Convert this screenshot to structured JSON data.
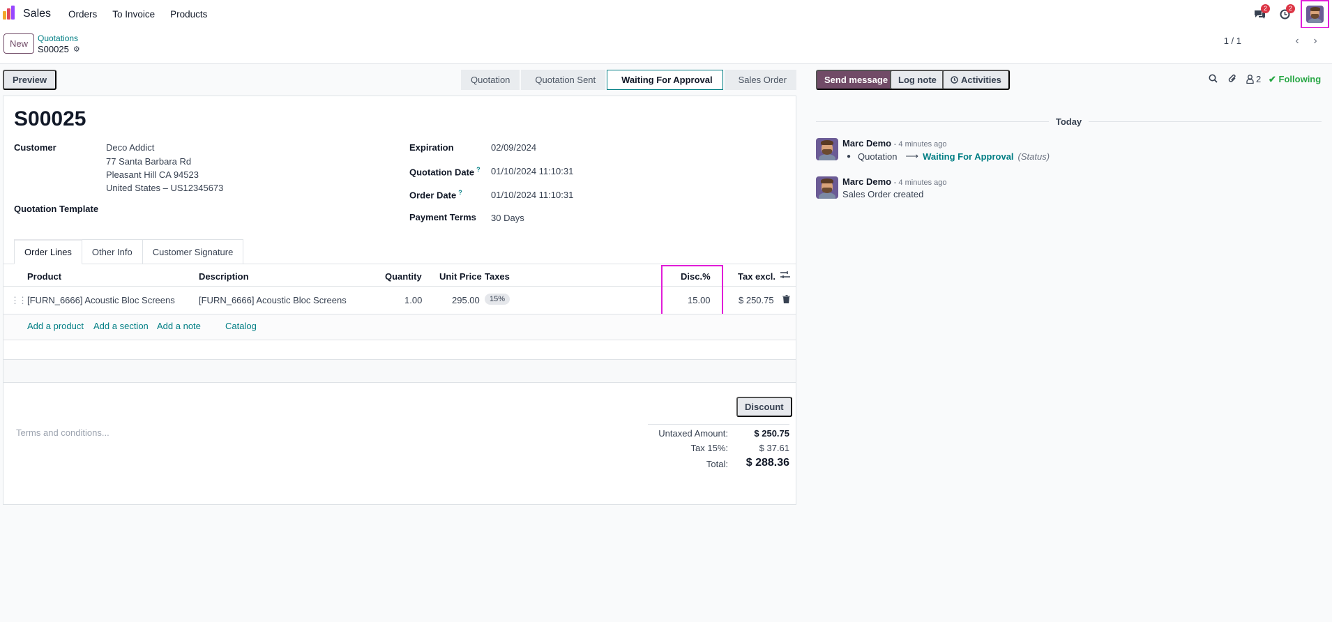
{
  "navbar": {
    "app_name": "Sales",
    "menu": [
      "Orders",
      "To Invoice",
      "Products"
    ],
    "messages_badge": "2",
    "activities_badge": "2",
    "brand_colors": [
      "#f2a62b",
      "#e0475b",
      "#9747ff"
    ]
  },
  "control": {
    "new_label": "New",
    "breadcrumb": "Quotations",
    "record_name": "S00025",
    "pager": "1 / 1"
  },
  "statusbar": {
    "preview_label": "Preview",
    "stages": [
      "Quotation",
      "Quotation Sent",
      "Waiting For Approval",
      "Sales Order"
    ],
    "active_stage": "Waiting For Approval"
  },
  "form": {
    "title": "S00025",
    "customer_label": "Customer",
    "customer_name": "Deco Addict",
    "customer_street": "77 Santa Barbara Rd",
    "customer_city": "Pleasant Hill CA 94523",
    "customer_country": "United States – US12345673",
    "template_label": "Quotation Template",
    "expiration_label": "Expiration",
    "expiration_value": "02/09/2024",
    "quotation_date_label": "Quotation Date",
    "quotation_date_value": "01/10/2024 11:10:31",
    "order_date_label": "Order Date",
    "order_date_value": "01/10/2024 11:10:31",
    "payment_terms_label": "Payment Terms",
    "payment_terms_value": "30 Days",
    "tabs": [
      "Order Lines",
      "Other Info",
      "Customer Signature"
    ]
  },
  "lines": {
    "headers": {
      "product": "Product",
      "description": "Description",
      "quantity": "Quantity",
      "unit_price": "Unit Price",
      "taxes": "Taxes",
      "discount": "Disc.%",
      "subtotal": "Tax excl."
    },
    "rows": [
      {
        "product": "[FURN_6666] Acoustic Bloc Screens",
        "description": "[FURN_6666] Acoustic Bloc Screens",
        "quantity": "1.00",
        "unit_price": "295.00",
        "taxes": "15%",
        "discount": "15.00",
        "subtotal": "$ 250.75"
      }
    ],
    "actions": [
      "Add a product",
      "Add a section",
      "Add a note",
      "Catalog"
    ]
  },
  "totals": {
    "discount_button": "Discount",
    "terms_placeholder": "Terms and conditions...",
    "untaxed_label": "Untaxed Amount:",
    "untaxed_value": "$ 250.75",
    "tax_label": "Tax 15%:",
    "tax_value": "$ 37.61",
    "total_label": "Total:",
    "total_value": "$ 288.36"
  },
  "chatter": {
    "send_message": "Send message",
    "log_note": "Log note",
    "activities": "Activities",
    "followers_count": "2",
    "following": "Following",
    "date_separator": "Today",
    "messages": [
      {
        "author": "Marc Demo",
        "time": "- 4 minutes ago",
        "old_value": "Quotation",
        "new_value": "Waiting For Approval",
        "field": "(Status)"
      },
      {
        "author": "Marc Demo",
        "time": "- 4 minutes ago",
        "body": "Sales Order created"
      }
    ]
  }
}
